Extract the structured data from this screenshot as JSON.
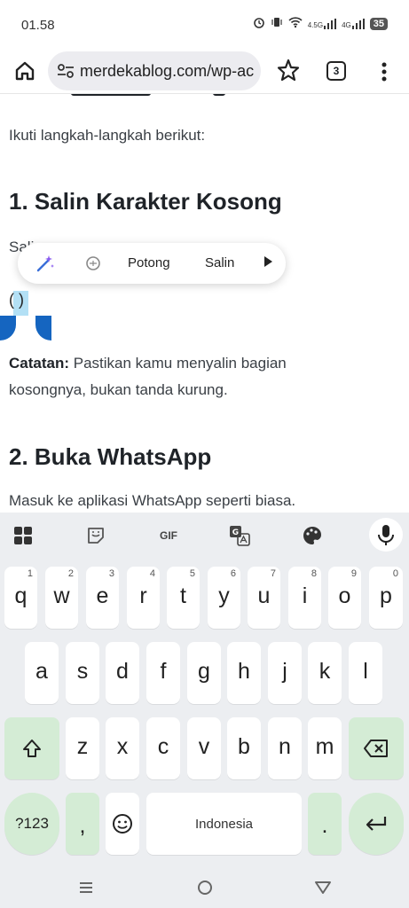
{
  "status_bar": {
    "time": "01.58",
    "net1": "4.5G",
    "net2": "4G",
    "battery": "35"
  },
  "browser": {
    "url": "merdekablog.com/wp-ac",
    "tab_count": "3",
    "icons": [
      "home-icon",
      "tune-icon",
      "star-icon",
      "tabs-icon",
      "more-vert-icon"
    ]
  },
  "article": {
    "intro": "Ikuti langkah-langkah berikut:",
    "section1_title": "1. Salin Karakter Kosong",
    "partial_line": "Sali",
    "selected_chars": "(    )",
    "note_label": "Catatan:",
    "note_line1": " Pastikan kamu menyalin bagian",
    "note_line2": "kosongnya, bukan tanda kurung.",
    "section2_title": "2. Buka WhatsApp",
    "section2_text": "Masuk ke aplikasi WhatsApp seperti biasa."
  },
  "context_menu": {
    "cut_label": "Potong",
    "copy_label": "Salin"
  },
  "keyboard": {
    "toolbar_gif": "GIF",
    "row1": [
      {
        "key": "q",
        "hint": "1"
      },
      {
        "key": "w",
        "hint": "2"
      },
      {
        "key": "e",
        "hint": "3"
      },
      {
        "key": "r",
        "hint": "4"
      },
      {
        "key": "t",
        "hint": "5"
      },
      {
        "key": "y",
        "hint": "6"
      },
      {
        "key": "u",
        "hint": "7"
      },
      {
        "key": "i",
        "hint": "8"
      },
      {
        "key": "o",
        "hint": "9"
      },
      {
        "key": "p",
        "hint": "0"
      }
    ],
    "row2": [
      "a",
      "s",
      "d",
      "f",
      "g",
      "h",
      "j",
      "k",
      "l"
    ],
    "row3": [
      "z",
      "x",
      "c",
      "v",
      "b",
      "n",
      "m"
    ],
    "symbols_label": "?123",
    "comma": ",",
    "period": ".",
    "space_label": "Indonesia",
    "accent_color": "#d4ecd5"
  }
}
